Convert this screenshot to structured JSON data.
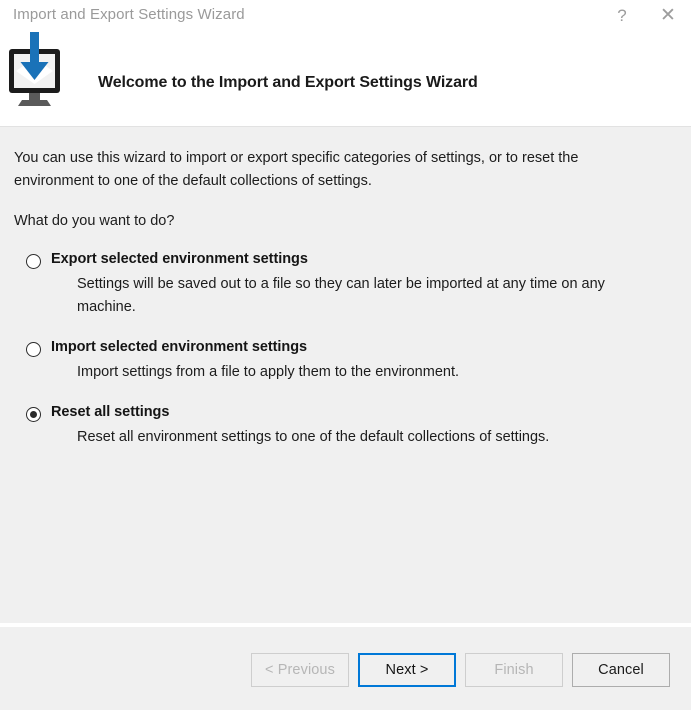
{
  "window": {
    "title": "Import and Export Settings Wizard",
    "help_icon": "question-mark-icon",
    "close_icon": "close-icon"
  },
  "header": {
    "heading": "Welcome to the Import and Export Settings Wizard",
    "icon": "monitor-download-icon",
    "icon_colors": {
      "arrow": "#1a72b8",
      "monitor_frame": "#1c1c1c",
      "screen": "#f2f2f2",
      "stand": "#5a5a5a"
    }
  },
  "content": {
    "intro": "You can use this wizard to import or export specific categories of settings, or to reset the environment to one of the default collections of settings.",
    "question": "What do you want to do?",
    "options": [
      {
        "label": "Export selected environment settings",
        "description": "Settings will be saved out to a file so they can later be imported at any time on any machine.",
        "selected": false
      },
      {
        "label": "Import selected environment settings",
        "description": "Import settings from a file to apply them to the environment.",
        "selected": false
      },
      {
        "label": "Reset all settings",
        "description": "Reset all environment settings to one of the default collections of settings.",
        "selected": true
      }
    ]
  },
  "footer": {
    "buttons": [
      {
        "label": "< Previous",
        "state": "disabled"
      },
      {
        "label": "Next >",
        "state": "focused"
      },
      {
        "label": "Finish",
        "state": "disabled"
      },
      {
        "label": "Cancel",
        "state": "normal"
      }
    ]
  },
  "colors": {
    "accent": "#0078d7",
    "content_background": "#f0f0f0",
    "title_text": "#9a9a9a",
    "body_text": "#1c1c1c"
  }
}
